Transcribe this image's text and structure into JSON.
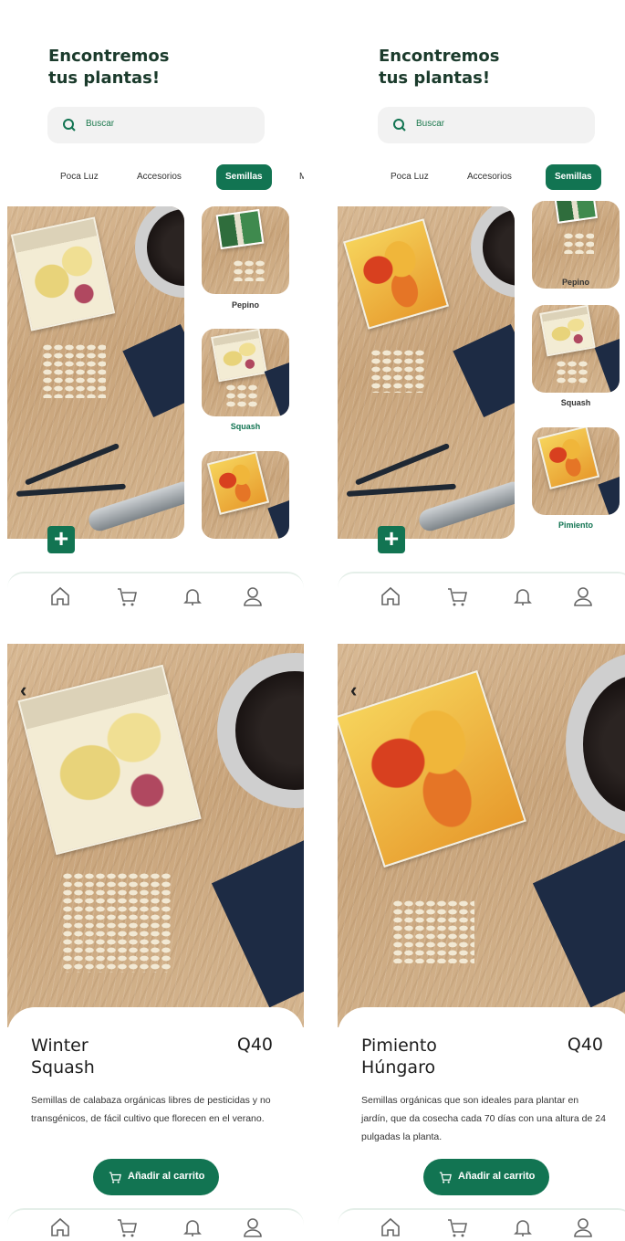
{
  "listing": {
    "title_line1": "Encontremos",
    "title_line2": "tus plantas!",
    "search_placeholder": "Buscar",
    "categories": [
      "Poca Luz",
      "Accesorios",
      "Semillas",
      "M"
    ],
    "active_category": "Semillas"
  },
  "screen1": {
    "thumbnails": [
      "Pepino",
      "Squash",
      ""
    ],
    "selected": "Squash"
  },
  "screen2": {
    "thumbnails": [
      "Pepino",
      "Squash",
      "Pimiento"
    ],
    "selected": "Pimiento"
  },
  "add_button_symbol": "+",
  "nav_icons": [
    "home-icon",
    "cart-icon",
    "bell-icon",
    "user-icon"
  ],
  "detail_squash": {
    "name_line1": "Winter",
    "name_line2": "Squash",
    "price": "Q40",
    "description": "Semillas de calabaza orgánicas libres de pesticidas y no transgénicos, de fácil cultivo que florecen en el verano.",
    "button_label": "Añadir al carrito"
  },
  "detail_pimiento": {
    "name_line1": "Pimiento",
    "name_line2": "Húngaro",
    "price": "Q40",
    "description": "Semillas orgánicas que son ideales para plantar en jardín, que da cosecha cada 70 días  con una altura de 24 pulgadas la planta.",
    "button_label": "Añadir al carrito"
  },
  "back_symbol": "‹",
  "colors": {
    "accent": "#127452",
    "title": "#1b3b2c"
  }
}
